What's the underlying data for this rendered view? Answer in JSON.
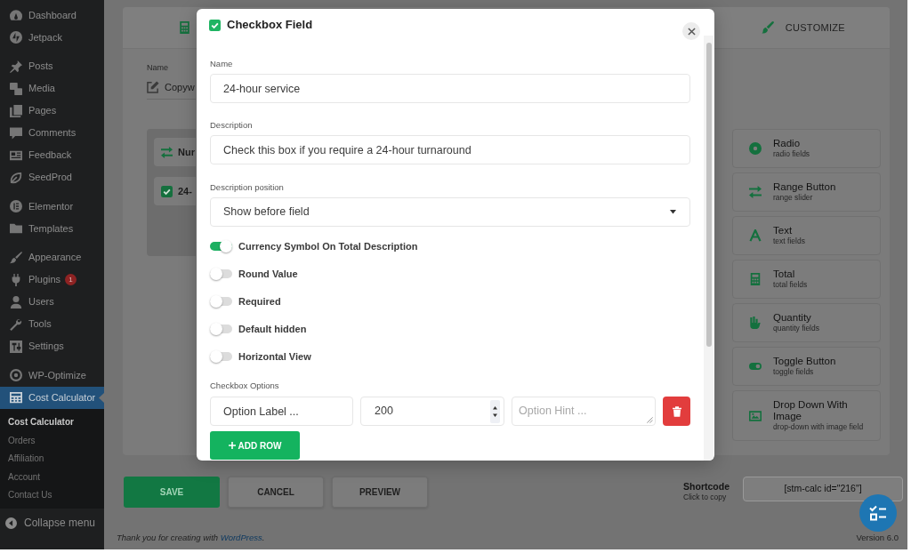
{
  "sidebar": {
    "groups": [
      {
        "items": [
          {
            "label": "Dashboard",
            "selected": false
          },
          {
            "label": "Jetpack",
            "selected": false
          }
        ]
      },
      {
        "items": [
          {
            "label": "Posts",
            "selected": false
          },
          {
            "label": "Media",
            "selected": false
          },
          {
            "label": "Pages",
            "selected": false
          },
          {
            "label": "Comments",
            "selected": false
          },
          {
            "label": "Feedback",
            "selected": false
          },
          {
            "label": "SeedProd",
            "selected": false
          }
        ]
      },
      {
        "items": [
          {
            "label": "Elementor",
            "selected": false
          },
          {
            "label": "Templates",
            "selected": false
          }
        ]
      },
      {
        "items": [
          {
            "label": "Appearance",
            "selected": false
          },
          {
            "label": "Plugins",
            "selected": false,
            "badge": "1"
          },
          {
            "label": "Users",
            "selected": false
          },
          {
            "label": "Tools",
            "selected": false
          },
          {
            "label": "Settings",
            "selected": false
          }
        ]
      },
      {
        "items": [
          {
            "label": "WP-Optimize",
            "selected": false
          },
          {
            "label": "Cost Calculator",
            "selected": true
          }
        ]
      }
    ],
    "submenu": [
      {
        "label": "Cost Calculator",
        "selected": true
      },
      {
        "label": "Orders",
        "selected": false
      },
      {
        "label": "Affiliation",
        "selected": false
      },
      {
        "label": "Account",
        "selected": false
      },
      {
        "label": "Contact Us",
        "selected": false
      }
    ],
    "collapse": "Collapse menu"
  },
  "builder": {
    "customize_tab": "CUSTOMIZE",
    "name_field": {
      "label": "Name",
      "value": "Copyw"
    },
    "field_list": [
      {
        "label": "Nur"
      },
      {
        "label": "24-"
      }
    ],
    "field_types": [
      {
        "title": "Radio",
        "subtitle": "radio fields"
      },
      {
        "title": "Range Button",
        "subtitle": "range slider"
      },
      {
        "title": "Text",
        "subtitle": "text fields"
      },
      {
        "title": "Total",
        "subtitle": "total fields"
      },
      {
        "title": "Quantity",
        "subtitle": "quantity fields"
      },
      {
        "title": "Toggle Button",
        "subtitle": "toggle fields"
      },
      {
        "title": "Drop Down With Image",
        "subtitle": "drop-down with image field"
      }
    ]
  },
  "modal": {
    "title": "Checkbox Field",
    "fields": [
      {
        "kind": "text",
        "label": "Name",
        "value": "24-hour service"
      },
      {
        "kind": "text",
        "label": "Description",
        "value": "Check this box if you require a 24-hour turnaround"
      },
      {
        "kind": "select",
        "label": "Description position",
        "value": "Show before field"
      }
    ],
    "toggles": [
      {
        "label": "Currency Symbol On Total Description",
        "on": true
      },
      {
        "label": "Round Value",
        "on": false
      },
      {
        "label": "Required",
        "on": false
      },
      {
        "label": "Default hidden",
        "on": false
      },
      {
        "label": "Horizontal View",
        "on": false
      }
    ],
    "options": {
      "label": "Checkbox Options",
      "rows": [
        {
          "label": {
            "value": "Option Label ..."
          },
          "price": {
            "value": "200"
          },
          "hint": {
            "placeholder": "Option Hint ..."
          }
        }
      ]
    },
    "add_row": "ADD ROW"
  },
  "actions": [
    {
      "label": "SAVE",
      "kind": "primary"
    },
    {
      "label": "CANCEL",
      "kind": "secondary"
    },
    {
      "label": "PREVIEW",
      "kind": "secondary"
    }
  ],
  "shortcode": {
    "title": "Shortcode",
    "hint": "Click to copy",
    "value": "[stm-calc id=\"216\"]"
  },
  "footer": {
    "text": "Thank you for creating with ",
    "link": "WordPress",
    "end": "."
  },
  "version": "Version 6.0"
}
